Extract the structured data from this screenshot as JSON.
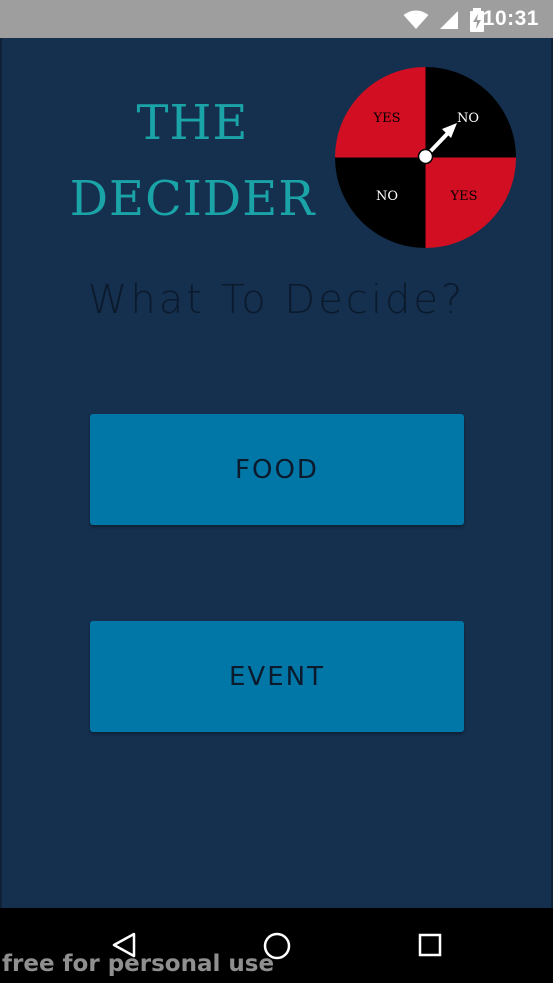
{
  "status_bar": {
    "time": "10:31",
    "icons": [
      "wifi-icon",
      "signal-icon",
      "battery-icon"
    ]
  },
  "header": {
    "title_line1": "THE",
    "title_line2": "DECIDER",
    "title_color": "#1ba4a8"
  },
  "wheel": {
    "segments": [
      {
        "label": "YES",
        "color": "#d20f22"
      },
      {
        "label": "NO",
        "color": "#000000"
      },
      {
        "label": "YES",
        "color": "#d20f22"
      },
      {
        "label": "NO",
        "color": "#000000"
      }
    ],
    "pointer": "arrow-icon"
  },
  "main": {
    "question": "What To Decide?",
    "buttons": [
      {
        "label": "FOOD"
      },
      {
        "label": "EVENT"
      }
    ],
    "background_color": "#15304f",
    "button_color": "#0077a6"
  },
  "nav": {
    "icons": [
      "back-icon",
      "home-icon",
      "recents-icon"
    ]
  },
  "watermark": "free for personal use"
}
